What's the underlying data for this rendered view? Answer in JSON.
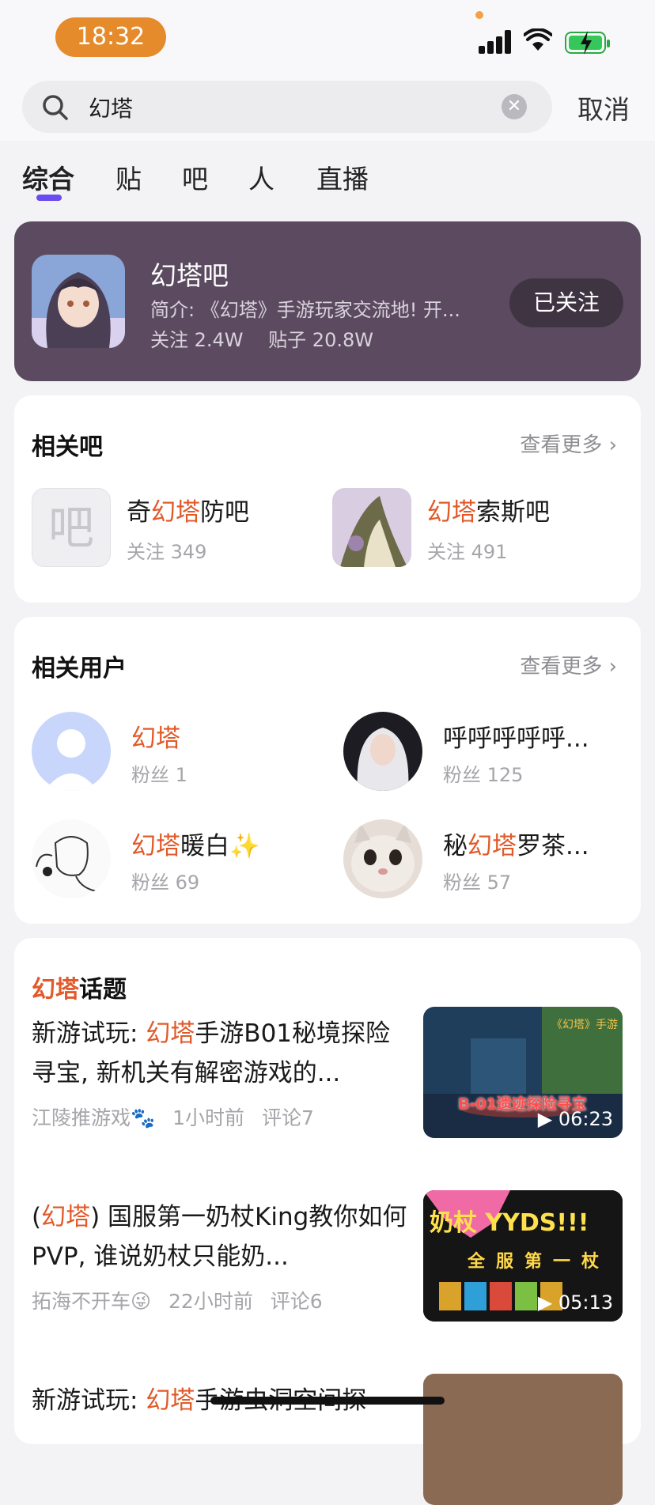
{
  "status_bar": {
    "time": "18:32"
  },
  "search": {
    "query": "幻塔",
    "cancel_label": "取消"
  },
  "tabs": [
    "综合",
    "贴",
    "吧",
    "人",
    "直播"
  ],
  "hero": {
    "name": "幻塔吧",
    "intro": "简介: 《幻塔》手游玩家交流地! 开...",
    "follow_count": "关注 2.4W",
    "post_count": "贴子 20.8W",
    "follow_label": "已关注"
  },
  "related_bars": {
    "title": "相关吧",
    "more": "查看更多",
    "items": [
      {
        "prefix": "奇",
        "highlight": "幻塔",
        "suffix": "防吧",
        "follow": "关注 349",
        "placeholder": "吧"
      },
      {
        "prefix": "",
        "highlight": "幻塔",
        "suffix": "索斯吧",
        "follow": "关注 491"
      }
    ]
  },
  "related_users": {
    "title": "相关用户",
    "more": "查看更多",
    "items": [
      {
        "prefix": "",
        "highlight": "幻塔",
        "suffix": "",
        "fans": "粉丝 1"
      },
      {
        "prefix": "呼呼呼呼呼...",
        "highlight": "",
        "suffix": "",
        "fans": "粉丝 125"
      },
      {
        "prefix": "",
        "highlight": "幻塔",
        "suffix": "暖白✨",
        "fans": "粉丝 69"
      },
      {
        "prefix": "秘",
        "highlight": "幻塔",
        "suffix": "罗茶...",
        "fans": "粉丝 57"
      }
    ]
  },
  "topics": {
    "title_highlight": "幻塔",
    "title_suffix": "话题",
    "items": [
      {
        "prefix": "新游试玩: ",
        "highlight": "幻塔",
        "suffix": "手游B01秘境探险寻宝, 新机关有解密游戏的...",
        "author": "江陵推游戏🐾",
        "time": "1小时前",
        "comments": "评论7",
        "duration": "06:23",
        "thumb_caption": "B-01遗迹探险寻宝",
        "thumb_tag": "《幻塔》手游"
      },
      {
        "prefix": "(",
        "highlight": "幻塔",
        "suffix": ") 国服第一奶杖King教你如何PVP, 谁说奶杖只能奶...",
        "author": "拓海不开车😜",
        "time": "22小时前",
        "comments": "评论6",
        "duration": "05:13",
        "thumb_caption": "奶杖 YYDS!!!",
        "thumb_tag": "全服第一杖"
      },
      {
        "prefix": "新游试玩: ",
        "highlight": "幻塔",
        "suffix": "手游虫洞空间探"
      }
    ]
  }
}
